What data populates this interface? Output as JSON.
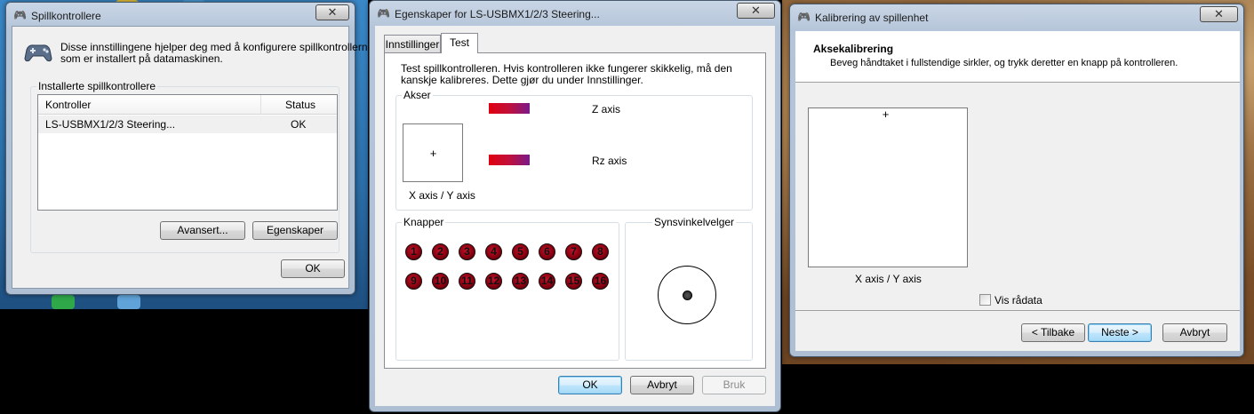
{
  "game_controllers": {
    "title": "Spillkontrollere",
    "close": "✕",
    "description_line1": "Disse innstillingene hjelper deg med å konfigurere spillkontrollerne",
    "description_line2": "som er installert på datamaskinen.",
    "group_label": "Installerte spillkontrollere",
    "columns": {
      "controller": "Kontroller",
      "status": "Status"
    },
    "rows": [
      {
        "controller": "LS-USBMX1/2/3 Steering...",
        "status": "OK"
      }
    ],
    "advanced_button": "Avansert...",
    "properties_button": "Egenskaper",
    "ok_button": "OK"
  },
  "properties": {
    "title": "Egenskaper for LS-USBMX1/2/3 Steering...",
    "close": "✕",
    "tabs": [
      {
        "label": "Innstillinger"
      },
      {
        "label": "Test"
      }
    ],
    "intro_line1": "Test spillkontrolleren. Hvis kontrolleren ikke fungerer skikkelig, må den",
    "intro_line2": "kanskje kalibreres. Dette gjør du under Innstillinger.",
    "axes_label": "Akser",
    "xy_label": "X axis / Y axis",
    "crosshair": "+",
    "z_label": "Z axis",
    "rz_label": "Rz axis",
    "buttons_label": "Knapper",
    "buttons": [
      "1",
      "2",
      "3",
      "4",
      "5",
      "6",
      "7",
      "8",
      "9",
      "10",
      "11",
      "12",
      "13",
      "14",
      "15",
      "16"
    ],
    "pov_label": "Synsvinkelvelger",
    "ok_button": "OK",
    "cancel_button": "Avbryt",
    "apply_button": "Bruk",
    "axis_bar_colors": [
      "#e00010",
      "#7a1a8a"
    ]
  },
  "calibration": {
    "title": "Kalibrering av spillenhet",
    "close": "✕",
    "heading": "Aksekalibrering",
    "instruction": "Beveg håndtaket i fullstendige sirkler, og trykk deretter en knapp på kontrolleren.",
    "crosshair": "+",
    "xy_label": "X axis / Y axis",
    "raw_data_label": "Vis rådata",
    "back_button": "< Tilbake",
    "next_button": "Neste >",
    "cancel_button": "Avbryt"
  },
  "colors": {
    "default_button_border": "#3c7fb1",
    "button_red": "#c0142a"
  }
}
